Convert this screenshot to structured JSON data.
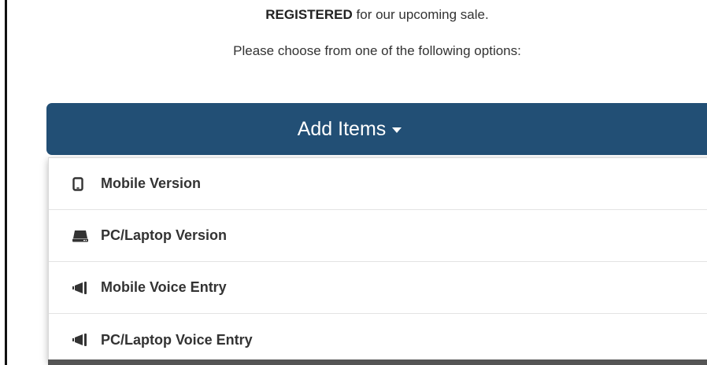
{
  "intro": {
    "bold_text": "REGISTERED",
    "rest_text": " for our upcoming sale.",
    "choose_text": "Please choose from one of the following options:"
  },
  "add_items": {
    "label": "Add Items",
    "color": "#224f75",
    "icon": "caret-down-icon"
  },
  "menu": {
    "items": [
      {
        "label": "Mobile Version",
        "icon": "mobile-phone-icon"
      },
      {
        "label": "PC/Laptop Version",
        "icon": "laptop-icon"
      },
      {
        "label": "Mobile Voice Entry",
        "icon": "bullhorn-icon"
      },
      {
        "label": "PC/Laptop Voice Entry",
        "icon": "bullhorn-icon"
      }
    ]
  }
}
